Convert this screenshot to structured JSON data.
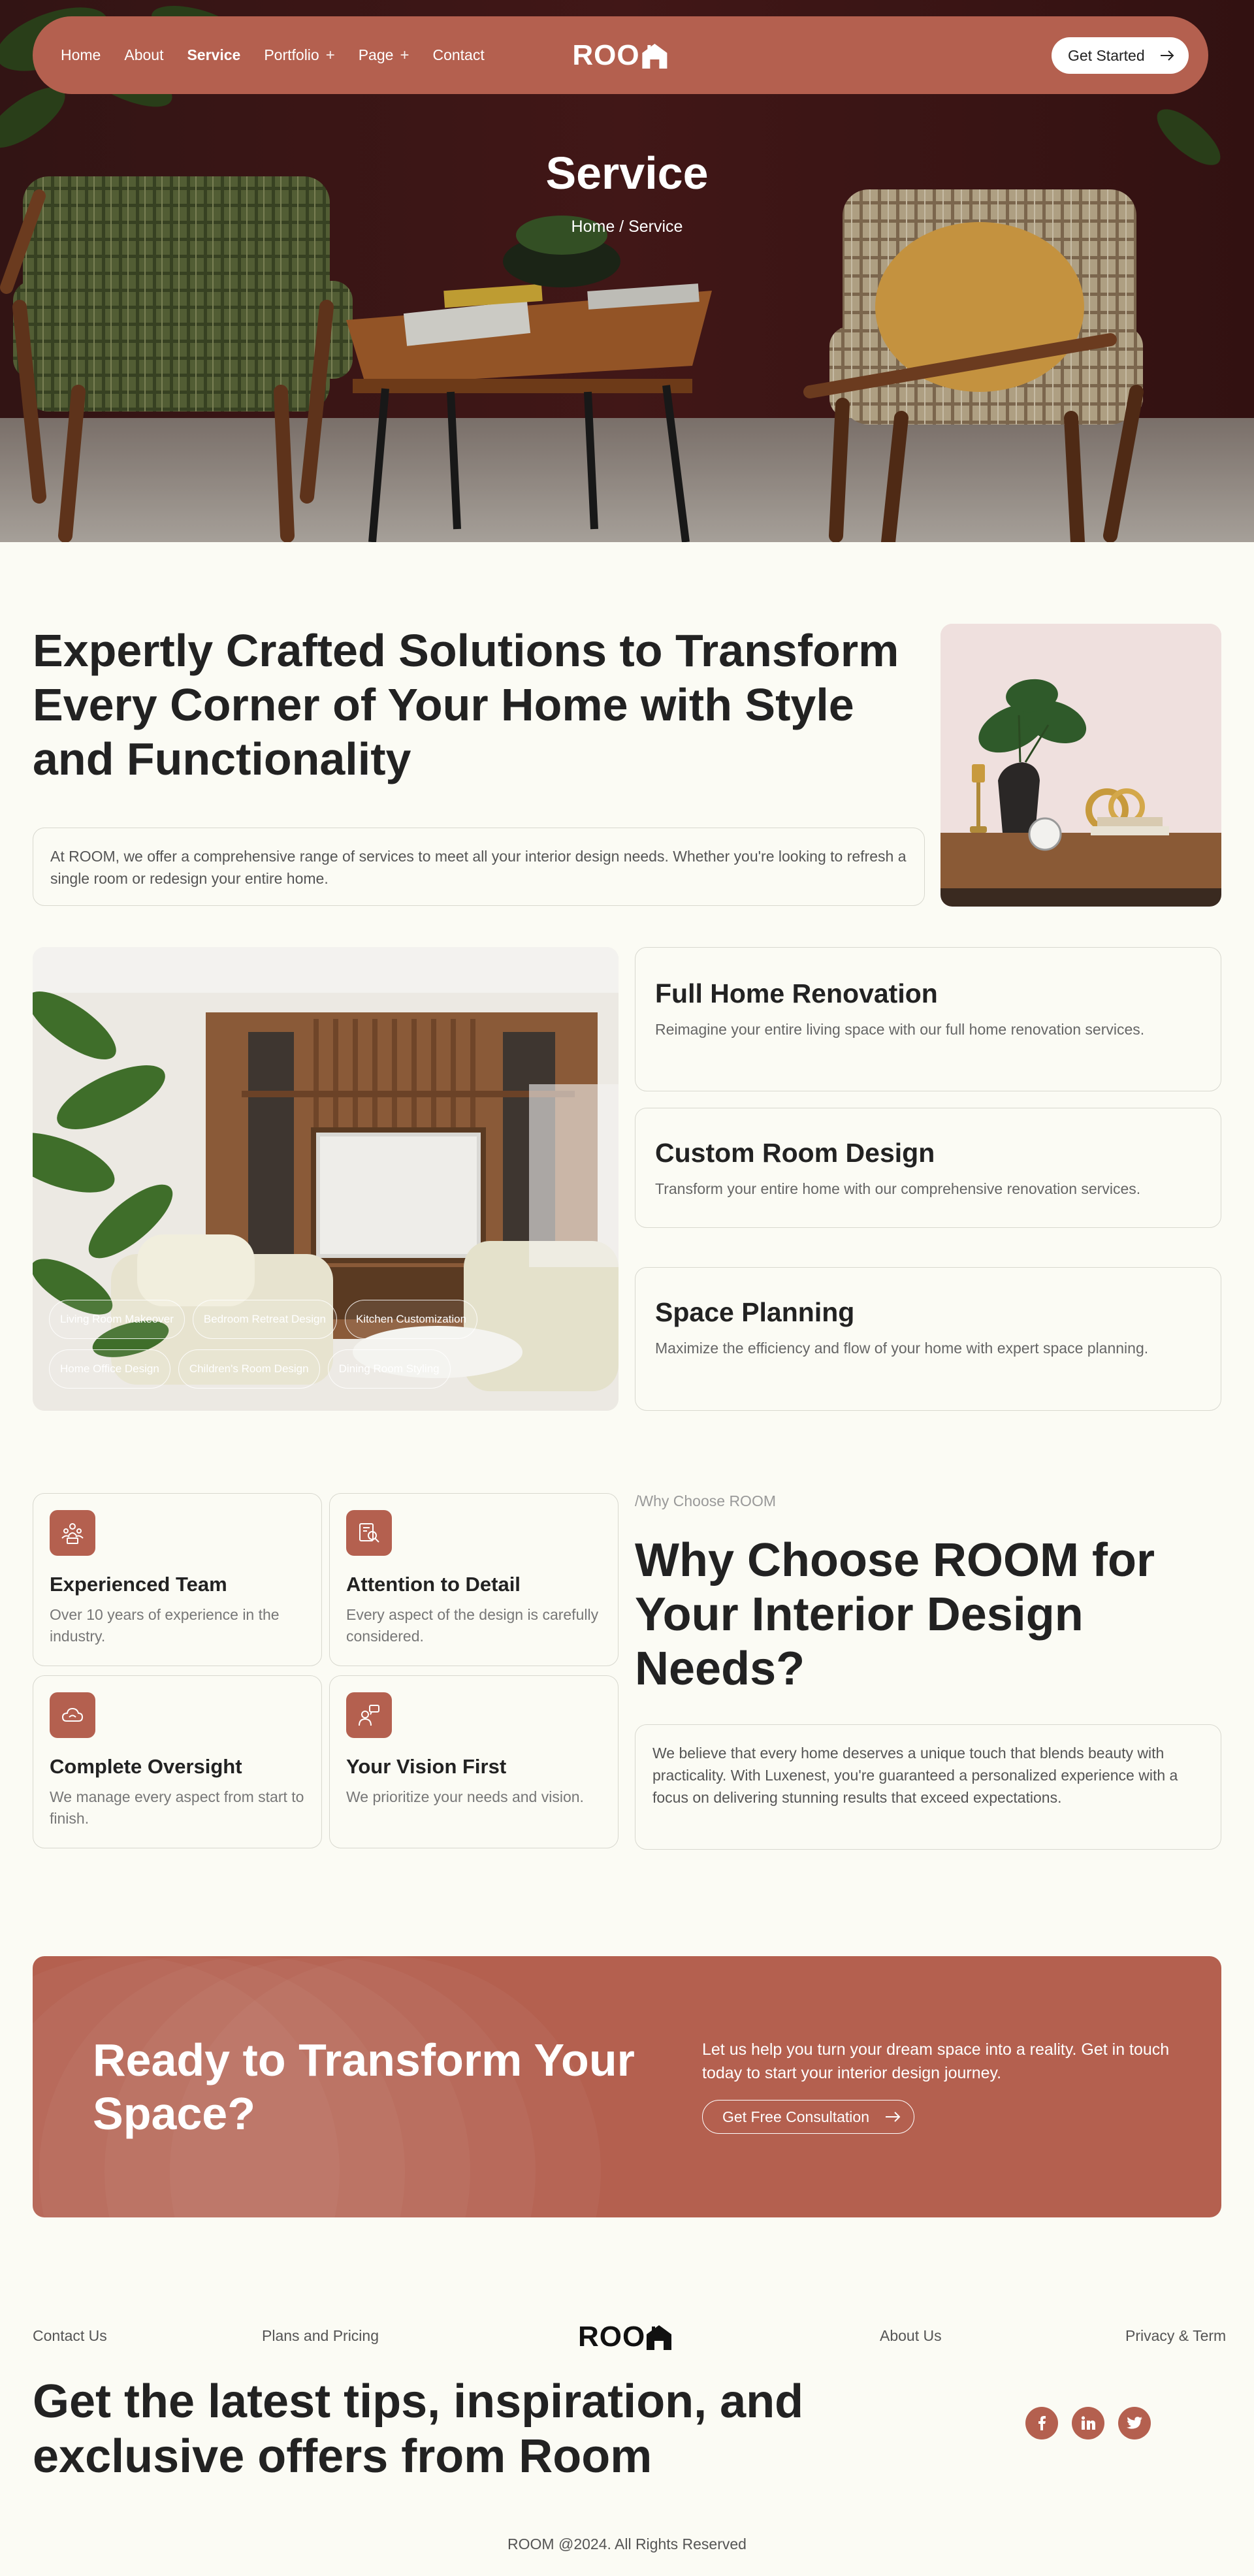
{
  "colors": {
    "accent": "#b4604f",
    "background": "#fbfbf4",
    "text": "#222222",
    "muted": "#777777",
    "border": "#d8d8cf"
  },
  "nav": {
    "links": [
      {
        "label": "Home",
        "dropdown": false,
        "active": false
      },
      {
        "label": "About",
        "dropdown": false,
        "active": false
      },
      {
        "label": "Service",
        "dropdown": false,
        "active": true
      },
      {
        "label": "Portfolio",
        "dropdown": true,
        "active": false
      },
      {
        "label": "Page",
        "dropdown": true,
        "active": false
      },
      {
        "label": "Contact",
        "dropdown": false,
        "active": false
      }
    ],
    "dropdown_symbol": "+",
    "logo": "ROO",
    "cta_label": "Get Started",
    "cta_icon": "arrow-right-icon"
  },
  "hero": {
    "title": "Service",
    "breadcrumb": "Home / Service"
  },
  "intro": {
    "heading": "Expertly Crafted Solutions to Transform Every Corner of Your Home with Style and Functionality",
    "text": "At ROOM, we offer a comprehensive range of services to meet all your interior design needs. Whether you're looking to refresh a single room or redesign your entire home."
  },
  "services": {
    "chips": [
      "Living Room Makeover",
      "Bedroom Retreat Design",
      "Kitchen Customization",
      "Home Office Design",
      "Children's Room Design",
      "Dining Room Styling"
    ],
    "cards": [
      {
        "title": "Full Home Renovation",
        "desc": "Reimagine your entire living space with our full home renovation services."
      },
      {
        "title": "Custom Room Design",
        "desc": "Transform your entire home with our comprehensive renovation services."
      },
      {
        "title": "Space Planning",
        "desc": "Maximize the efficiency and flow of your home with expert space planning."
      }
    ]
  },
  "why": {
    "kicker": "/Why Choose ROOM",
    "heading": "Why Choose ROOM for Your Interior Design Needs?",
    "text": "We believe that every home deserves a unique touch that blends beauty with practicality. With Luxenest, you're guaranteed a personalized experience with a focus on delivering stunning results that exceed expectations.",
    "features": [
      {
        "title": "Experienced Team",
        "desc": "Over 10 years of experience in the industry.",
        "icon": "team-icon"
      },
      {
        "title": "Attention to Detail",
        "desc": "Every aspect of the design is carefully considered.",
        "icon": "magnifier-icon"
      },
      {
        "title": "Complete Oversight",
        "desc": "We manage every aspect from start to finish.",
        "icon": "cloud-icon"
      },
      {
        "title": "Your Vision First",
        "desc": "We prioritize your needs and vision.",
        "icon": "person-idea-icon"
      }
    ]
  },
  "cta": {
    "heading": "Ready to Transform Your Space?",
    "text": "Let us help you turn your dream space into a reality. Get in touch today to start your interior design journey.",
    "button": "Get Free Consultation"
  },
  "footer": {
    "links": [
      "Contact Us",
      "Plans and Pricing",
      "About Us",
      "Privacy & Term"
    ],
    "logo": "ROO",
    "newsletter": "Get the latest tips, inspiration, and exclusive offers from Room",
    "socials": [
      "facebook-icon",
      "linkedin-icon",
      "twitter-icon"
    ],
    "copyright": "ROOM @2024. All Rights Reserved"
  }
}
